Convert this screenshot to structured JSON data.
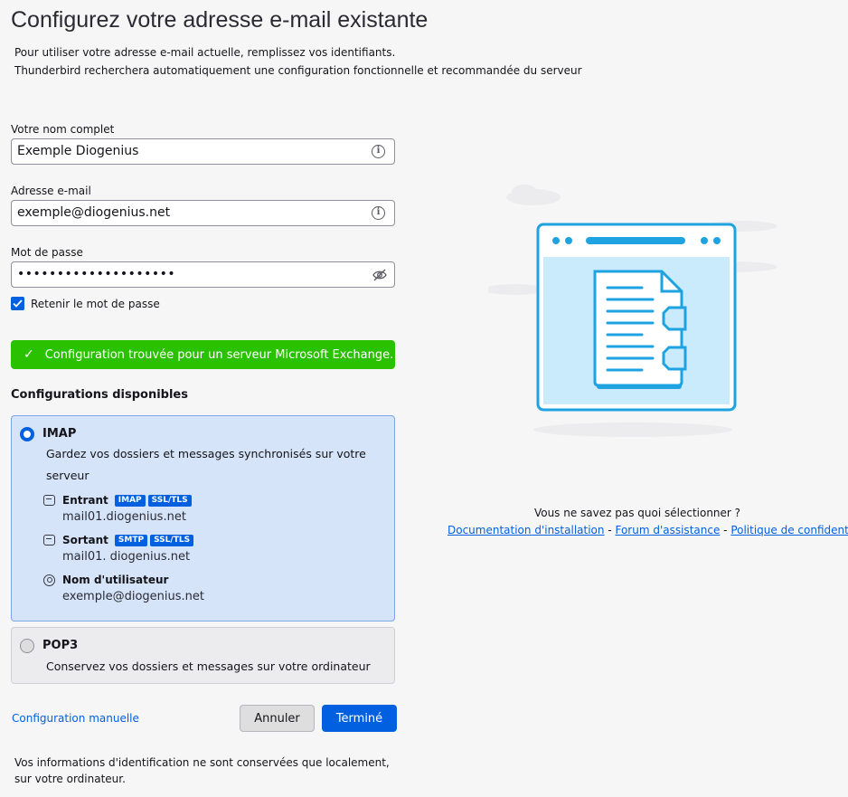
{
  "page": {
    "title": "Configurez votre adresse e-mail existante",
    "description_line1": "Pour utiliser votre adresse e-mail actuelle, remplissez vos identifiants.",
    "description_line2": "Thunderbird recherchera automatiquement une configuration fonctionnelle et recommandée du serveur"
  },
  "form": {
    "name_label": "Votre nom complet",
    "name_value": "Exemple Diogenius",
    "email_label": "Adresse e-mail",
    "email_value": "exemple@diogenius.net",
    "password_label": "Mot de passe",
    "password_value": "••••••••••••••••••••",
    "remember_label": "Retenir le mot de passe",
    "remember_checked": true
  },
  "status": {
    "check_glyph": "✓",
    "message": "Configuration trouvée pour un serveur Microsoft Exchange."
  },
  "configurations": {
    "title": "Configurations disponibles",
    "imap": {
      "name": "IMAP",
      "selected": true,
      "description": "Gardez vos dossiers et messages synchronisés sur votre serveur",
      "incoming_label": "Entrant",
      "incoming_badges": [
        "IMAP",
        "SSL/TLS"
      ],
      "incoming_host": "mail01.diogenius.net",
      "outgoing_label": "Sortant",
      "outgoing_badges": [
        "SMTP",
        "SSL/TLS"
      ],
      "outgoing_host": "mail01. diogenius.net",
      "username_label": "Nom d'utilisateur",
      "username_value": "exemple@diogenius.net"
    },
    "pop3": {
      "name": "POP3",
      "selected": false,
      "description": "Conservez vos dossiers et messages sur votre ordinateur"
    }
  },
  "actions": {
    "manual_config": "Configuration manuelle",
    "cancel": "Annuler",
    "done": "Terminé"
  },
  "footer_note": "Vos informations d'identification ne sont conservées que localement, sur votre ordinateur.",
  "help": {
    "question": "Vous ne savez pas quoi sélectionner ?",
    "link_docs": "Documentation d'installation",
    "link_forum": "Forum d'assistance",
    "link_privacy": "Politique de confidentialité",
    "separator": " - "
  },
  "colors": {
    "accent": "#0060df",
    "success": "#2ac200",
    "illustration_blue": "#1fa3e0"
  }
}
